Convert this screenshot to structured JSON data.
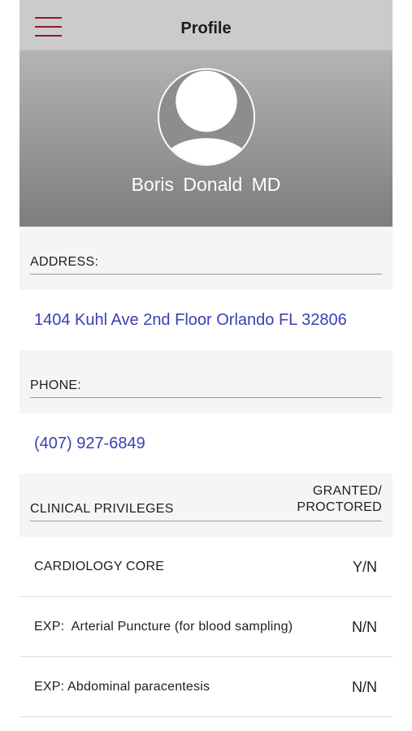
{
  "header": {
    "title": "Profile",
    "menu_icon": "hamburger-menu-icon",
    "accent": "#8e1a2b"
  },
  "profile": {
    "name": "Boris  Donald  MD",
    "avatar_icon": "user-avatar-icon"
  },
  "address": {
    "label": "ADDRESS:",
    "value": "1404 Kuhl Ave 2nd Floor Orlando FL 32806"
  },
  "phone": {
    "label": "PHONE:",
    "value": "(407) 927-6849"
  },
  "privileges": {
    "label": "CLINICAL PRIVILEGES",
    "status_header_line1": "GRANTED/",
    "status_header_line2": "PROCTORED",
    "items": [
      {
        "name": "CARDIOLOGY CORE",
        "status": "Y/N"
      },
      {
        "name": "EXP:  Arterial Puncture (for blood sampling)",
        "status": "N/N"
      },
      {
        "name": "EXP: Abdominal paracentesis",
        "status": "N/N"
      }
    ]
  },
  "link_color": "#3b3fb3"
}
